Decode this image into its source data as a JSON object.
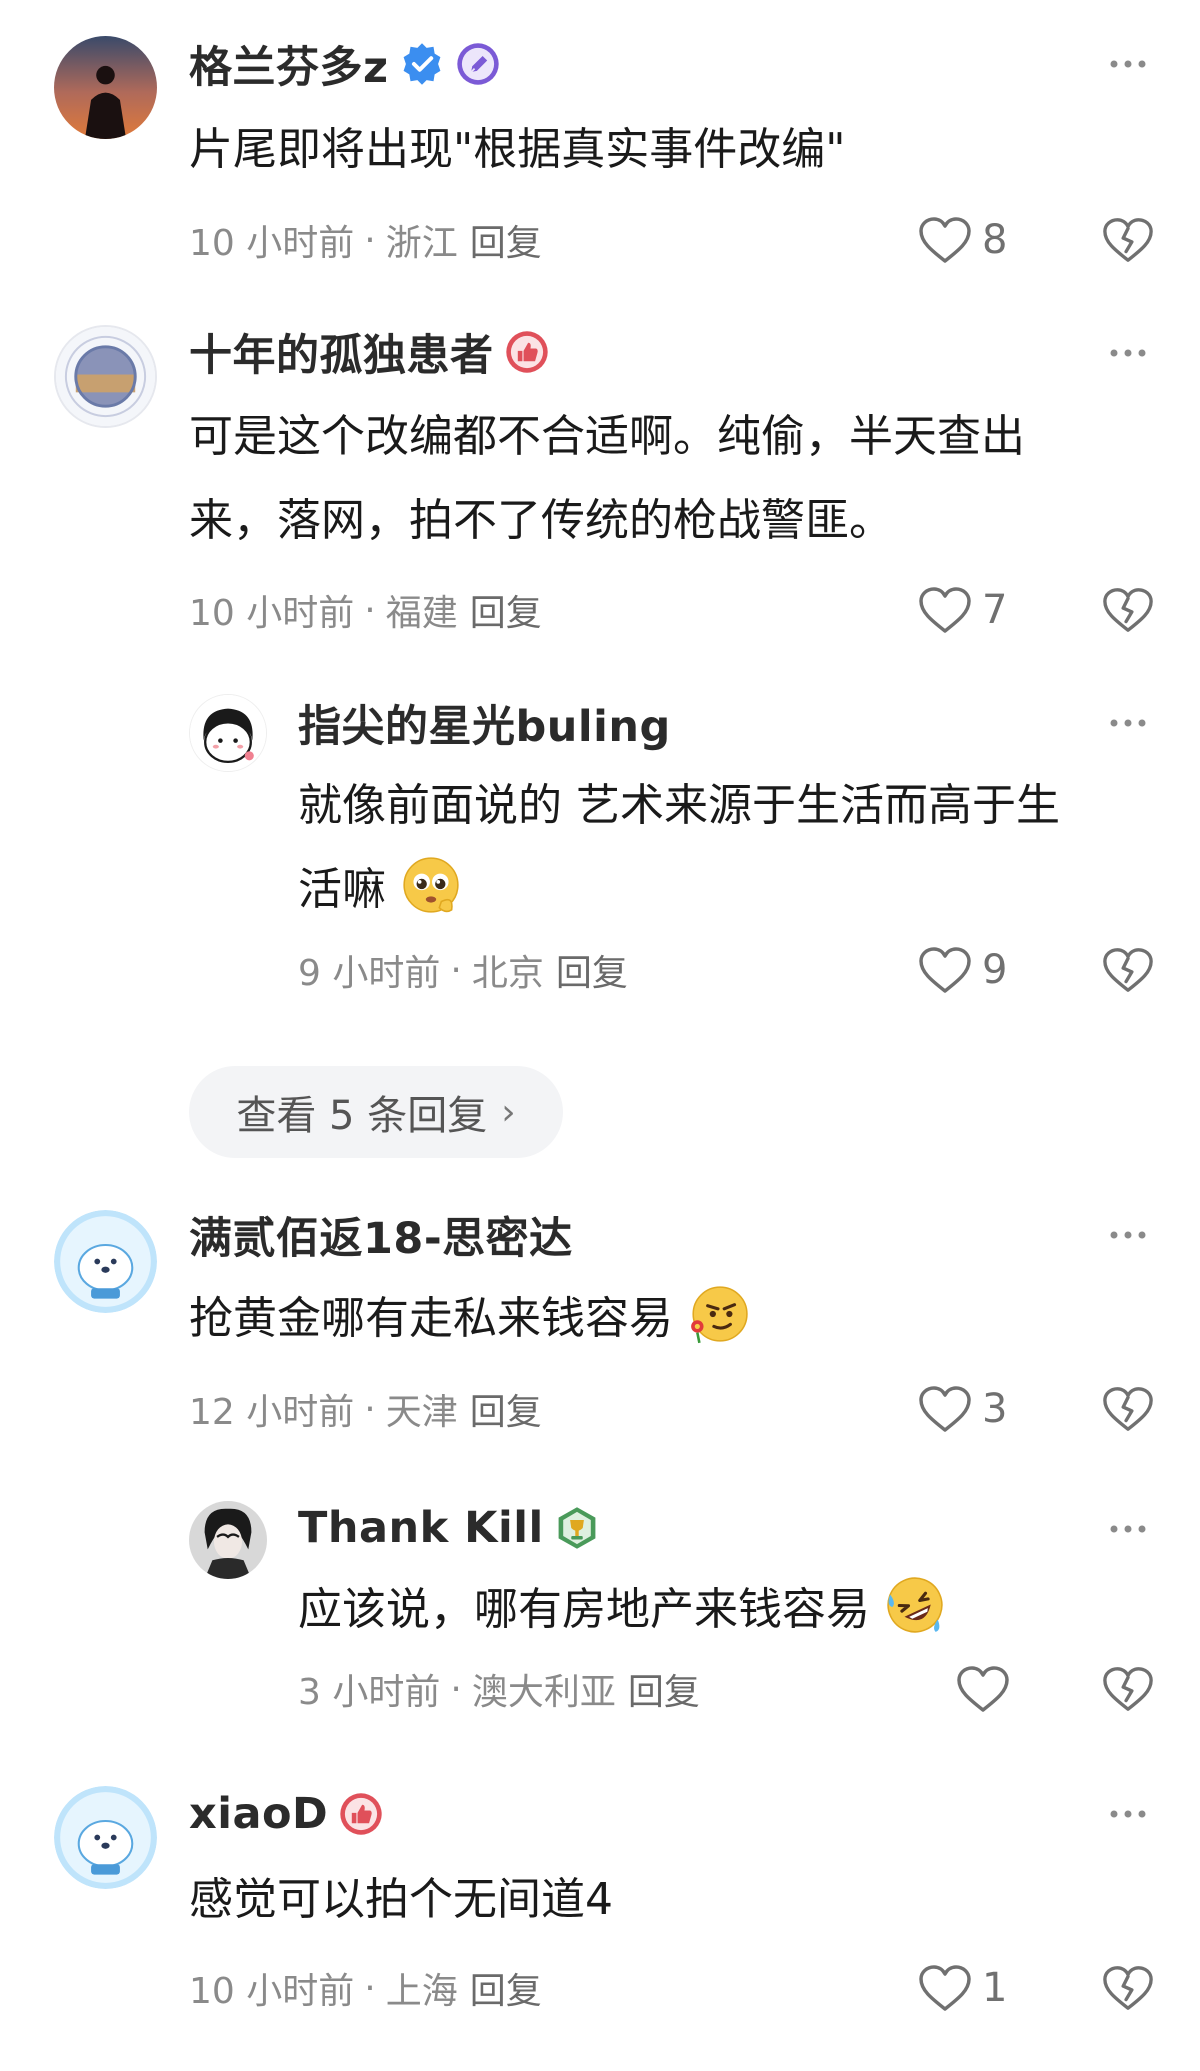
{
  "comments": [
    {
      "username": "格兰芬多z",
      "text": "片尾即将出现\"根据真实事件改编\"",
      "time": "10 小时前",
      "location": "浙江",
      "reply_label": "回复",
      "likes": "8"
    },
    {
      "username": "十年的孤独患者",
      "text_line1": "可是这个改编都不合适啊。纯偷，半天查出",
      "text_line2": "来，落网，拍不了传统的枪战警匪。",
      "time": "10 小时前",
      "location": "福建",
      "reply_label": "回复",
      "likes": "7"
    },
    {
      "username": "指尖的星光buling",
      "text_line1": "就像前面说的 艺术来源于生活而高于生",
      "text_line2": "活嘛",
      "time": "9 小时前",
      "location": "北京",
      "reply_label": "回复",
      "likes": "9"
    },
    {
      "username": "满贰佰返18-思密达",
      "text": "抢黄金哪有走私来钱容易",
      "time": "12 小时前",
      "location": "天津",
      "reply_label": "回复",
      "likes": "3"
    },
    {
      "username": "Thank Kill",
      "text": "应该说，哪有房地产来钱容易",
      "time": "3 小时前",
      "location": "澳大利亚",
      "reply_label": "回复",
      "likes": ""
    },
    {
      "username": "xiaoD",
      "text": "感觉可以拍个无间道4",
      "time": "10 小时前",
      "location": "上海",
      "reply_label": "回复",
      "likes": "1"
    }
  ],
  "view_more": {
    "label": "查看 5 条回复",
    "chevron": "›"
  },
  "meta_separator": "·",
  "icons": {
    "more": "more-dots-icon",
    "like": "heart-outline-icon",
    "dislike": "broken-heart-icon",
    "verified": "verified-check-icon",
    "pen_badge": "pen-badge-icon",
    "thumb_badge": "thumbs-up-badge-icon",
    "trophy_badge": "trophy-badge-icon"
  },
  "colors": {
    "username": "#2b2b2b",
    "meta": "#8a8a8a",
    "verified": "#3b8ef0",
    "pen_badge": "#7b5ad6",
    "thumb_badge": "#e0505a",
    "trophy_badge": "#4a9a5a",
    "pill_bg": "#f3f4f6"
  }
}
